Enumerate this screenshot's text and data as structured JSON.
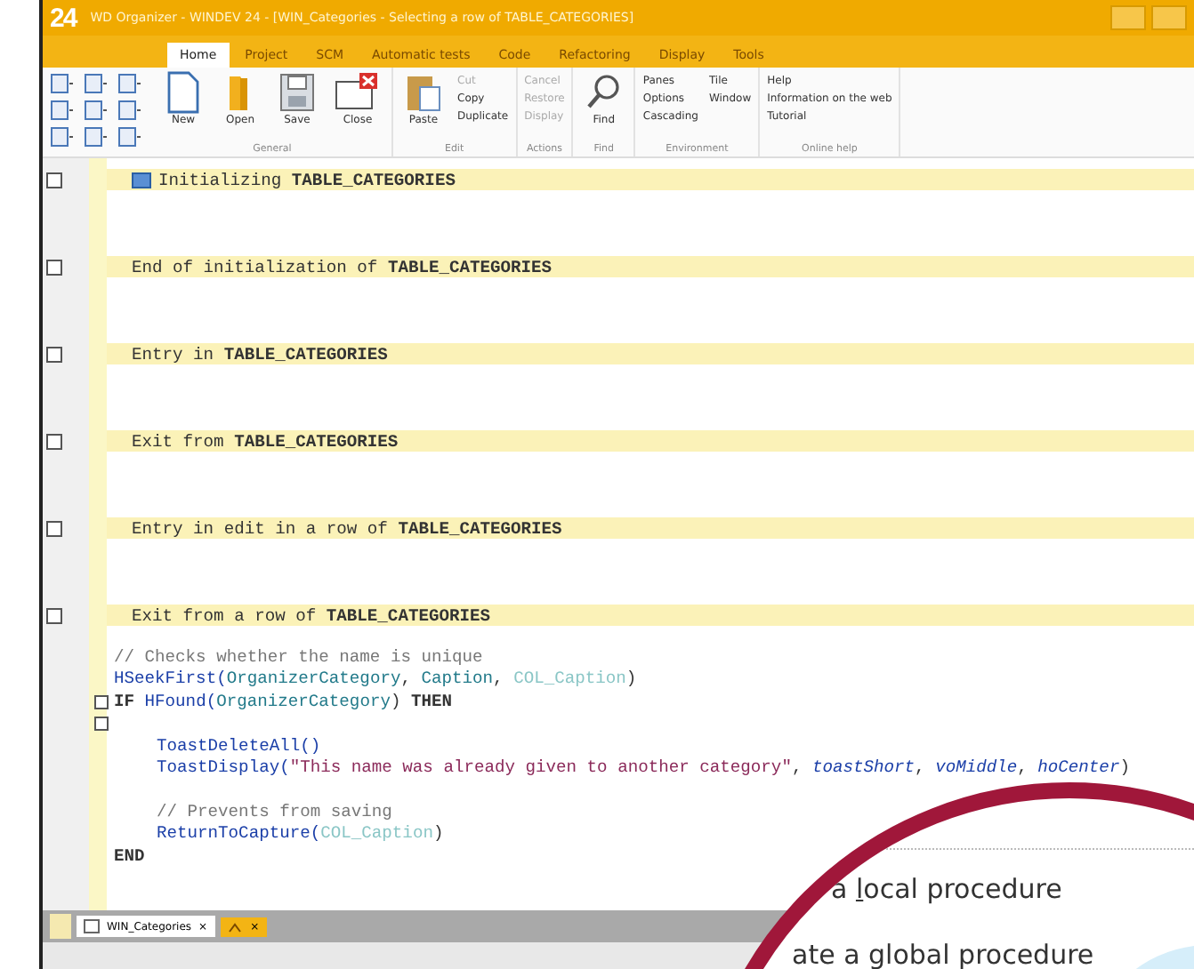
{
  "window": {
    "logo": "24",
    "title": "WD Organizer - WINDEV 24 - [WIN_Categories - Selecting a row of TABLE_CATEGORIES]"
  },
  "tabs": [
    {
      "label": "Home",
      "selected": true
    },
    {
      "label": "Project",
      "selected": false
    },
    {
      "label": "SCM",
      "selected": false
    },
    {
      "label": "Automatic tests",
      "selected": false
    },
    {
      "label": "Code",
      "selected": false
    },
    {
      "label": "Refactoring",
      "selected": false
    },
    {
      "label": "Display",
      "selected": false
    },
    {
      "label": "Tools",
      "selected": false
    }
  ],
  "ribbon": [
    {
      "label": "General",
      "items": [
        {
          "kind": "large",
          "label": "New"
        },
        {
          "kind": "large",
          "label": "Open"
        },
        {
          "kind": "large",
          "label": "Save"
        },
        {
          "kind": "large",
          "label": "Close"
        }
      ]
    },
    {
      "label": "Edit",
      "items": [
        {
          "kind": "large",
          "label": "Paste"
        },
        {
          "kind": "stack",
          "entries": [
            {
              "label": "Cut",
              "disabled": true
            },
            {
              "label": "Copy",
              "disabled": false
            },
            {
              "label": "Duplicate",
              "disabled": false
            }
          ]
        }
      ]
    },
    {
      "label": "Actions",
      "items": [
        {
          "kind": "stack",
          "entries": [
            {
              "label": "Cancel",
              "disabled": true
            },
            {
              "label": "Restore",
              "disabled": true
            },
            {
              "label": "Display",
              "disabled": true
            }
          ]
        }
      ]
    },
    {
      "label": "Find",
      "items": [
        {
          "kind": "large",
          "label": "Find"
        }
      ]
    },
    {
      "label": "Environment",
      "items": [
        {
          "kind": "stack",
          "entries": [
            {
              "label": "Panes",
              "disabled": false
            },
            {
              "label": "Options",
              "disabled": false
            },
            {
              "label": "Cascading",
              "disabled": false
            }
          ]
        },
        {
          "kind": "stack",
          "entries": [
            {
              "label": "Tile",
              "disabled": false
            },
            {
              "label": "Window",
              "disabled": false
            }
          ]
        }
      ]
    },
    {
      "label": "Online help",
      "items": [
        {
          "kind": "stack",
          "entries": [
            {
              "label": "Help",
              "disabled": false
            },
            {
              "label": "Information on the web",
              "disabled": false
            },
            {
              "label": "Tutorial",
              "disabled": false
            }
          ]
        }
      ]
    }
  ],
  "sections": [
    {
      "title": "Initializing **TABLE_CATEGORIES**",
      "icon": true
    },
    {
      "title": "End of initialization of **TABLE_CATEGORIES**",
      "icon": false
    },
    {
      "title": "Entry in **TABLE_CATEGORIES**",
      "icon": false
    },
    {
      "title": "Exit from **TABLE_CATEGORIES**",
      "icon": false
    },
    {
      "title": "Entry in edit in a row of **TABLE_CATEGORIES**",
      "icon": false
    },
    {
      "title": "Exit from a row of **TABLE_CATEGORIES**",
      "icon": false
    }
  ],
  "code_lines": [
    {
      "fold": false,
      "tokens": [
        {
          "kind": "comment",
          "text": "// Checks whether the name is unique"
        }
      ]
    },
    {
      "fold": false,
      "tokens": [
        {
          "kind": "function",
          "text": "HSeekFirst("
        },
        {
          "kind": "variable",
          "text": "OrganizerCategory"
        },
        {
          "kind": "plain",
          "text": ", "
        },
        {
          "kind": "variable",
          "text": "Caption"
        },
        {
          "kind": "plain",
          "text": ", "
        },
        {
          "kind": "control",
          "text": "COL_Caption"
        },
        {
          "kind": "plain",
          "text": ")"
        }
      ]
    },
    {
      "fold": true,
      "tokens": [
        {
          "kind": "keyword",
          "text": "IF "
        },
        {
          "kind": "function",
          "text": "HFound("
        },
        {
          "kind": "variable",
          "text": "OrganizerCategory"
        },
        {
          "kind": "plain",
          "text": ") "
        },
        {
          "kind": "keyword",
          "text": "THEN"
        }
      ],
      "children": [
        {
          "fold": true
        },
        {
          "fold": false,
          "tokens": [
            {
              "kind": "function",
              "text": "ToastDeleteAll()"
            }
          ]
        },
        {
          "fold": false,
          "tokens": [
            {
              "kind": "function",
              "text": "ToastDisplay("
            },
            {
              "kind": "string",
              "text": "\"This name was already given to another category\""
            },
            {
              "kind": "plain",
              "text": ", "
            },
            {
              "kind": "constant",
              "text": "toastShort"
            },
            {
              "kind": "plain",
              "text": ", "
            },
            {
              "kind": "constant",
              "text": "voMiddle"
            },
            {
              "kind": "plain",
              "text": ", "
            },
            {
              "kind": "constant",
              "text": "hoCenter"
            },
            {
              "kind": "plain",
              "text": ")"
            }
          ]
        },
        {
          "fold": false
        },
        {
          "fold": false,
          "tokens": [
            {
              "kind": "comment",
              "text": "// Prevents from saving"
            }
          ]
        },
        {
          "fold": false,
          "tokens": [
            {
              "kind": "function",
              "text": "ReturnToCapture("
            },
            {
              "kind": "control",
              "text": "COL_Caption"
            },
            {
              "kind": "plain",
              "text": ")"
            }
          ]
        }
      ]
    },
    {
      "fold": false,
      "tokens": [
        {
          "kind": "keyword",
          "text": "END"
        }
      ]
    }
  ],
  "bottom_tabs": [
    {
      "kind": "window",
      "label": "WIN_Categories",
      "close": "×",
      "selected": false
    },
    {
      "kind": "icon",
      "close": "×",
      "selected": true
    }
  ],
  "magnifier": {
    "items": [
      {
        "before": "a ",
        "accelerator": "l",
        "after": "ocal procedure"
      },
      {
        "before": "ate a global procedure"
      }
    ]
  }
}
